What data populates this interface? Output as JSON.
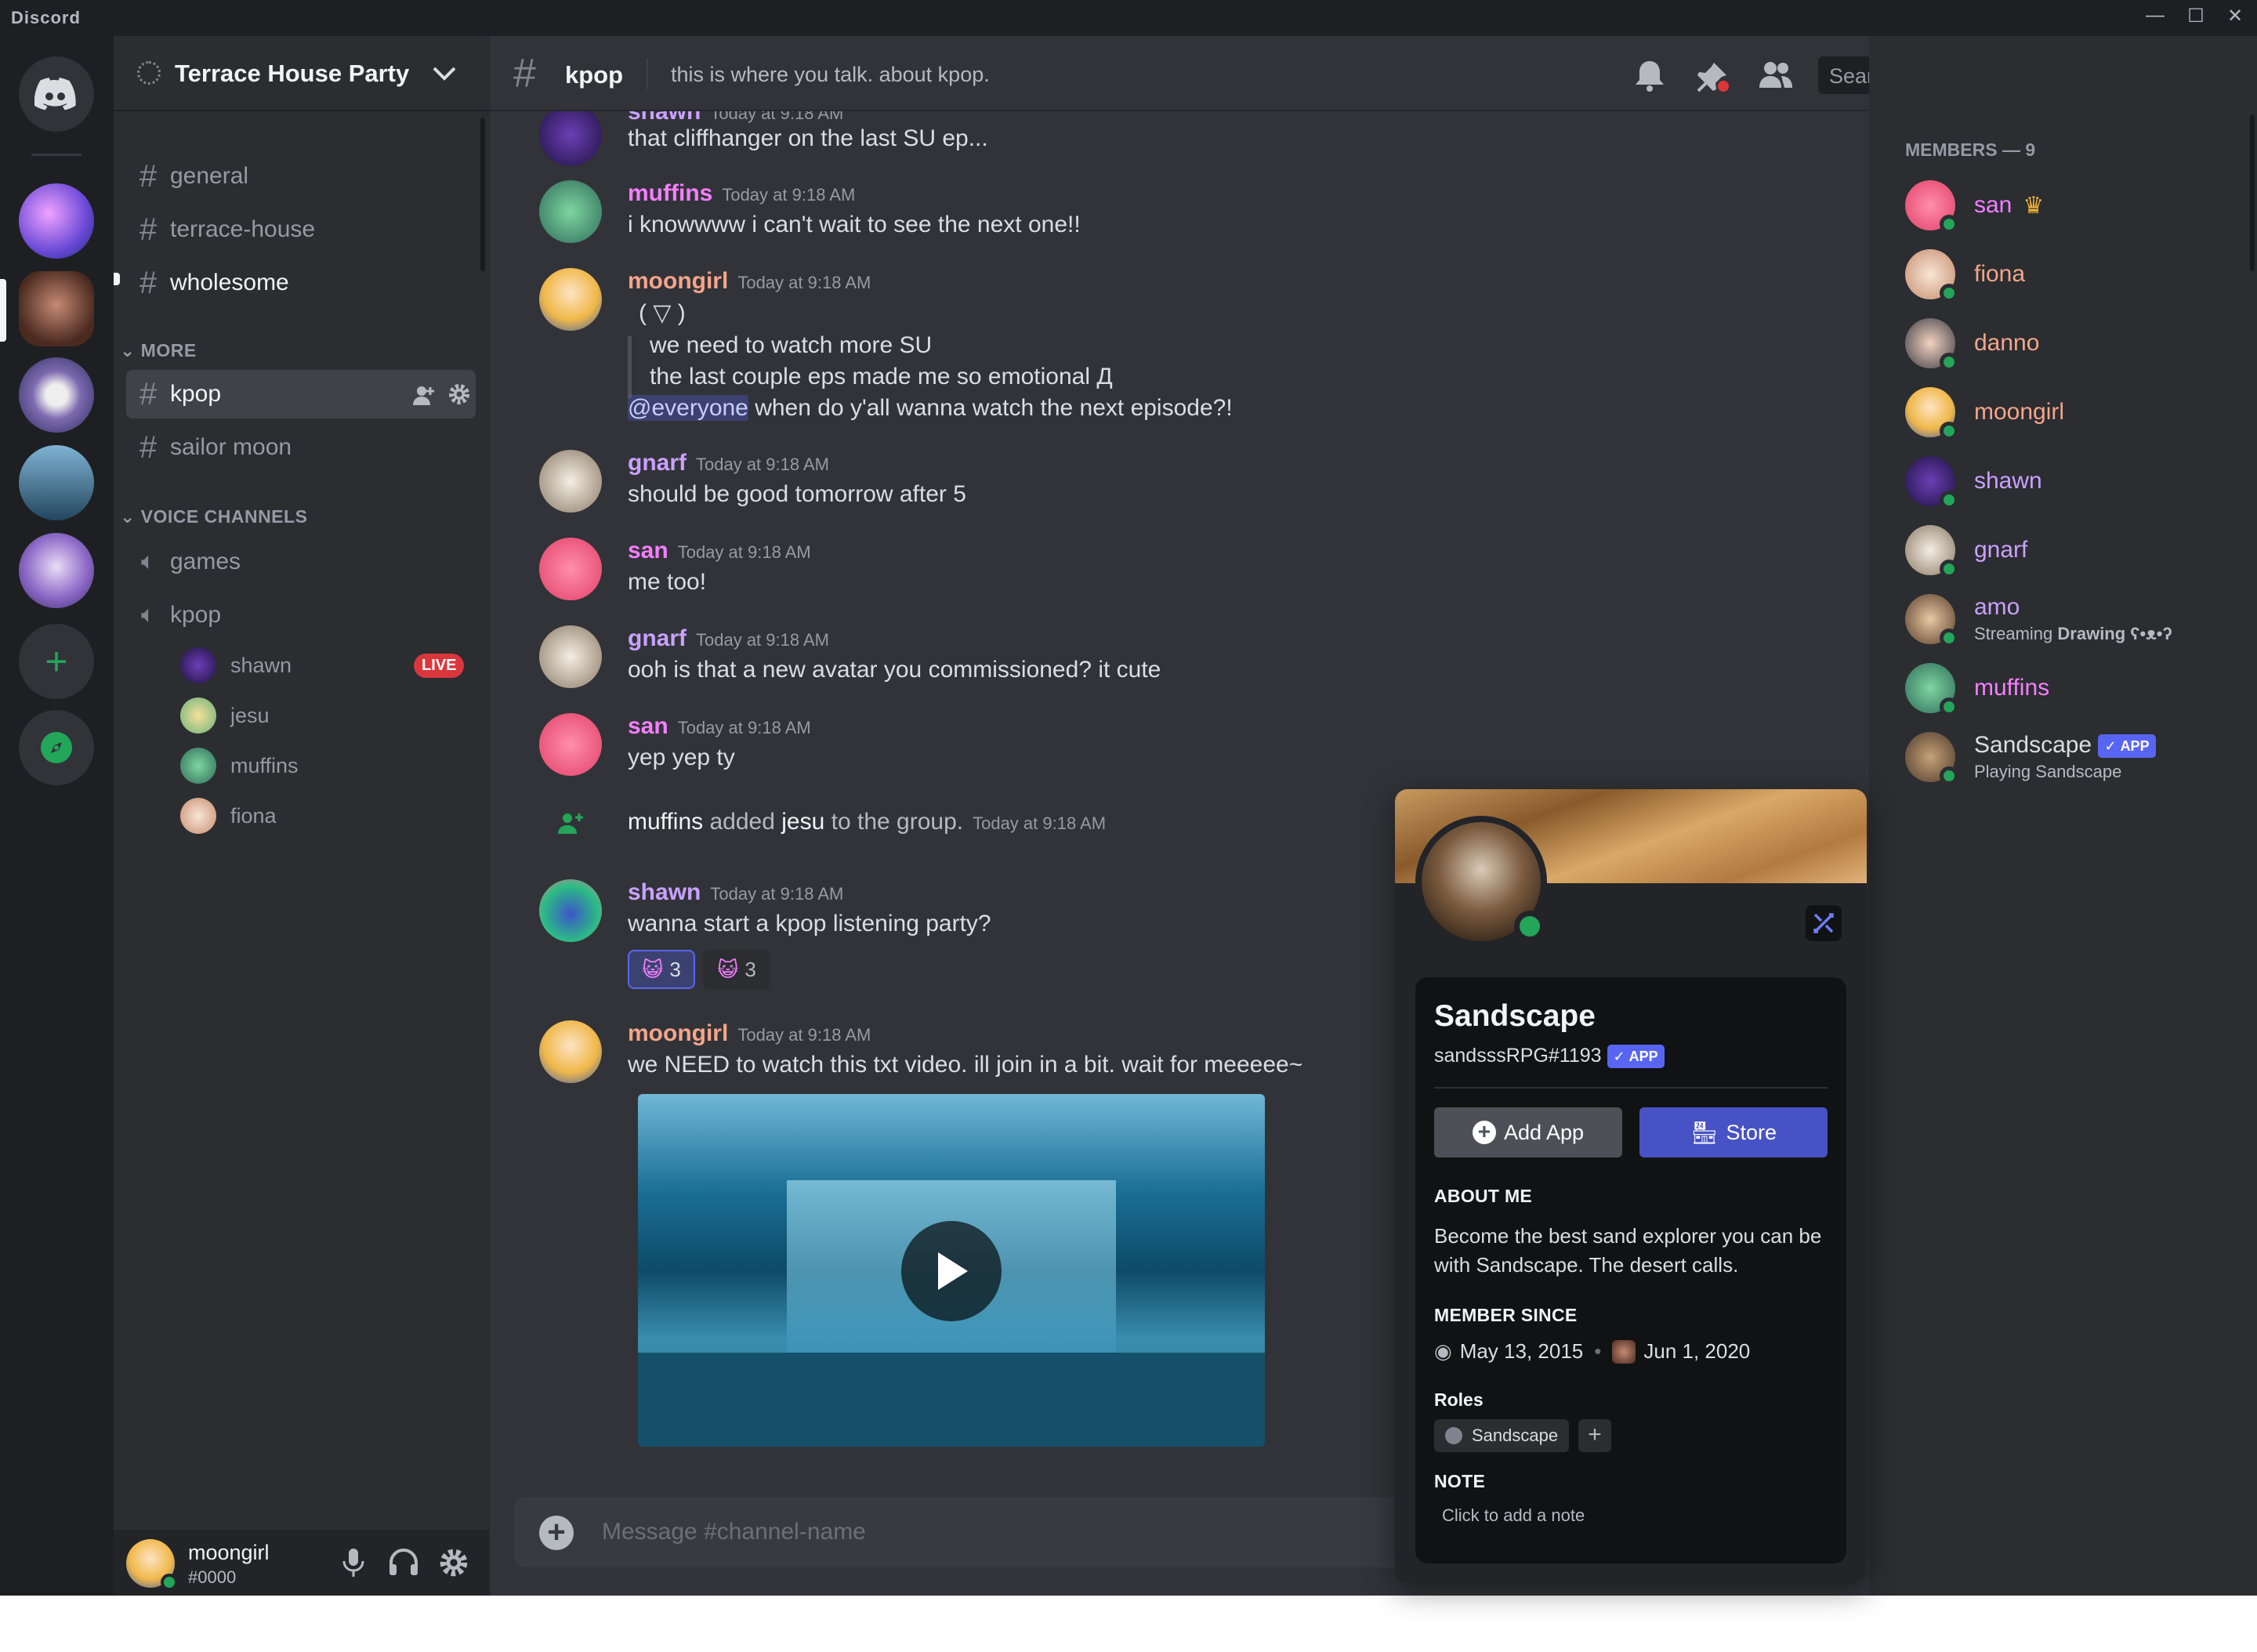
{
  "window": {
    "brand": "Discord",
    "minimize": "—",
    "maximize": "☐",
    "close": "✕"
  },
  "server": {
    "name": "Terrace House Party"
  },
  "channels": {
    "text": [
      {
        "name": "general"
      },
      {
        "name": "terrace-house"
      },
      {
        "name": "wholesome"
      }
    ],
    "more_label": "MORE",
    "more": [
      {
        "name": "kpop"
      },
      {
        "name": "sailor moon"
      }
    ],
    "voice_label": "VOICE CHANNELS",
    "voice": [
      {
        "name": "games"
      },
      {
        "name": "kpop"
      }
    ],
    "voice_users": [
      {
        "name": "shawn",
        "badge": "LIVE"
      },
      {
        "name": "jesu"
      },
      {
        "name": "muffins"
      },
      {
        "name": "fiona"
      }
    ]
  },
  "user": {
    "name": "moongirl",
    "tag": "#0000"
  },
  "channel_header": {
    "name": "kpop",
    "topic": "this is where you talk. about kpop.",
    "search_placeholder": "Search"
  },
  "messages": [
    {
      "author": "shawn",
      "time": "Today at 9:18 AM",
      "text": "that cliffhanger on the last SU ep..."
    },
    {
      "author": "muffins",
      "time": "Today at 9:18 AM",
      "text": "i knowwww i can't wait to see the next one!!"
    },
    {
      "author": "moongirl",
      "time": "Today at 9:18 AM",
      "lines": [
        "( ▽ )",
        "we need to watch more SU",
        "the last couple eps made me so emotional    Д"
      ],
      "mention": "@everyone",
      "mention_text": " when do y'all wanna watch the next episode?!"
    },
    {
      "author": "gnarf",
      "time": "Today at 9:18 AM",
      "text": "should be good tomorrow after 5"
    },
    {
      "author": "san",
      "time": "Today at 9:18 AM",
      "text": "me too!"
    },
    {
      "author": "gnarf",
      "time": "Today at 9:18 AM",
      "text": "ooh is that a new avatar you commissioned? it cute"
    },
    {
      "author": "san",
      "time": "Today at 9:18 AM",
      "text": "yep yep ty"
    },
    {
      "system": true,
      "actor": "muffins",
      "action": " added ",
      "target": "jesu",
      "suffix": " to the group.",
      "time": "Today at 9:18 AM"
    },
    {
      "author": "shawn",
      "time": "Today at 9:18 AM",
      "text": "wanna start a kpop listening party?",
      "reactions": [
        {
          "count": "3"
        },
        {
          "count": "3"
        }
      ]
    },
    {
      "author": "moongirl",
      "time": "Today at 9:18 AM",
      "text": "we NEED to watch this txt video. ill join in a bit. wait for meeeee~"
    }
  ],
  "composer": {
    "placeholder": "Message #channel-name"
  },
  "members": {
    "header": "MEMBERS — 9",
    "list": [
      {
        "name": "san",
        "color": "#f47fff"
      },
      {
        "name": "fiona",
        "color": "#f4a58a"
      },
      {
        "name": "danno",
        "color": "#f4a58a"
      },
      {
        "name": "moongirl",
        "color": "#f4a58a"
      },
      {
        "name": "shawn",
        "color": "#c9a1ff"
      },
      {
        "name": "gnarf",
        "color": "#c9a1ff"
      },
      {
        "name": "amo",
        "color": "#c9a1ff",
        "status_prefix": "Streaming ",
        "status_bold": "Drawing ʕ•ᴥ•ʔ"
      },
      {
        "name": "muffins",
        "color": "#f47fff"
      },
      {
        "name": "Sandscape",
        "color": "#dbdee1",
        "badge": "APP",
        "status": "Playing Sandscape"
      }
    ]
  },
  "profile": {
    "name": "Sandscape",
    "handle": "sandsssRPG#1193",
    "badge": "APP",
    "add_app": "Add App",
    "store": "Store",
    "about_label": "ABOUT ME",
    "about": "Become the best sand explorer you can be with Sandscape. The desert calls.",
    "since_label": "MEMBER SINCE",
    "since_discord": "May 13, 2015",
    "since_server": "Jun 1, 2020",
    "roles_label": "Roles",
    "role": "Sandscape",
    "note_label": "NOTE",
    "note_placeholder": "Click to add a note"
  },
  "colors": {
    "accent": "#5865f2",
    "online": "#23a55a",
    "live": "#da373c",
    "bg": "#313338",
    "sidebar": "#2b2d31",
    "guildbar": "#1e1f22"
  }
}
